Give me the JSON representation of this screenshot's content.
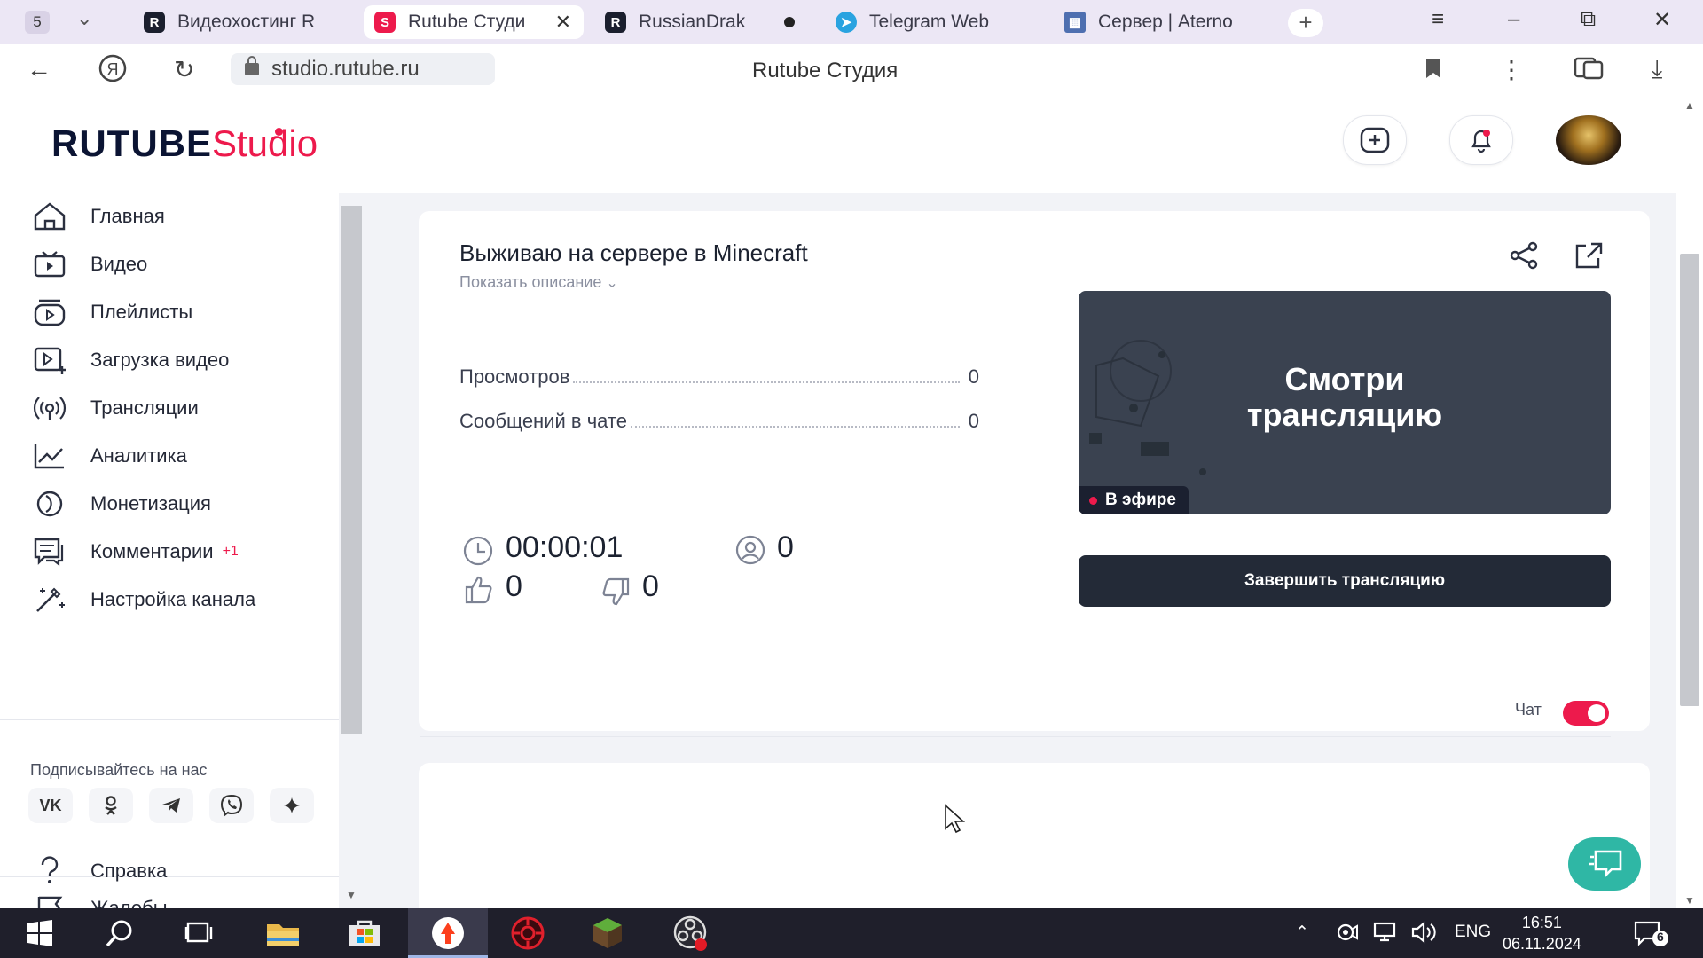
{
  "browser": {
    "tab_count": "5",
    "tabs": [
      {
        "title": "Видеохостинг R",
        "icon": "rutube-icon",
        "active": false
      },
      {
        "title": "Rutube Студи",
        "icon": "rutube-studio-icon",
        "active": true
      },
      {
        "title": "RussianDrak",
        "icon": "rutube-icon",
        "active": false
      },
      {
        "title": "Telegram Web",
        "icon": "telegram-icon",
        "active": false
      },
      {
        "title": "Сервер | Aterno",
        "icon": "aternos-icon",
        "active": false
      }
    ],
    "url": "studio.rutube.ru",
    "page_title": "Rutube Студия"
  },
  "header": {
    "logo_main": "RUTUBE",
    "logo_sub": "Studio"
  },
  "sidebar": {
    "items": [
      {
        "label": "Главная",
        "icon": "home-icon"
      },
      {
        "label": "Видео",
        "icon": "video-icon"
      },
      {
        "label": "Плейлисты",
        "icon": "playlist-icon"
      },
      {
        "label": "Загрузка видео",
        "icon": "upload-video-icon"
      },
      {
        "label": "Трансляции",
        "icon": "broadcast-icon"
      },
      {
        "label": "Аналитика",
        "icon": "analytics-icon"
      },
      {
        "label": "Монетизация",
        "icon": "monetization-icon"
      },
      {
        "label": "Комментарии",
        "icon": "comments-icon",
        "badge": "+1"
      },
      {
        "label": "Настройка канала",
        "icon": "channel-settings-icon"
      }
    ],
    "follow_label": "Подписывайтесь на нас",
    "social": [
      "vk-icon",
      "ok-icon",
      "telegram-icon",
      "viber-icon",
      "sparkle-icon"
    ],
    "vk_text": "VK",
    "bottom_items": [
      {
        "label": "Жалобы",
        "icon": "flag-icon"
      },
      {
        "label": "Справка",
        "icon": "help-icon"
      }
    ]
  },
  "stream": {
    "title": "Выживаю на сервере в Minecraft",
    "show_description": "Показать описание",
    "stats": [
      {
        "label": "Просмотров",
        "value": "0"
      },
      {
        "label": "Сообщений в чате",
        "value": "0"
      }
    ],
    "duration": "00:00:01",
    "viewers": "0",
    "likes": "0",
    "dislikes": "0",
    "preview_text_line1": "Смотри",
    "preview_text_line2": "трансляцию",
    "live_label": "В эфире",
    "end_button": "Завершить трансляцию"
  },
  "chat": {
    "label": "Чат",
    "enabled": true
  },
  "taskbar": {
    "language": "ENG",
    "time": "16:51",
    "date": "06.11.2024",
    "notifications": "6"
  },
  "colors": {
    "brand": "#ed1a4c",
    "dark_button": "#232a37",
    "support": "#2fb7a5"
  }
}
